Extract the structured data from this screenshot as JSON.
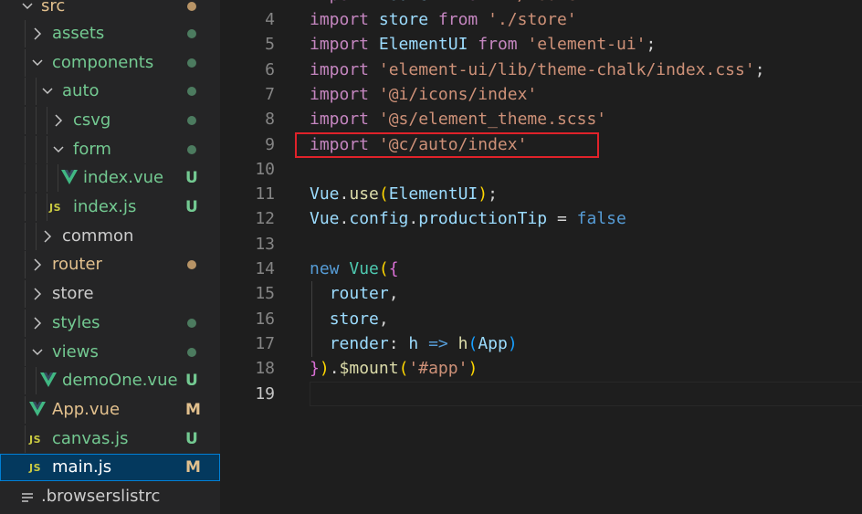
{
  "explorer": {
    "items": [
      {
        "label": "src",
        "status": "dot"
      },
      {
        "label": "assets",
        "status": "dot"
      },
      {
        "label": "components",
        "status": "dot"
      },
      {
        "label": "auto",
        "status": "dot"
      },
      {
        "label": "csvg",
        "status": "dot"
      },
      {
        "label": "form",
        "status": "dot"
      },
      {
        "label": "index.vue",
        "status": "U"
      },
      {
        "label": "index.js",
        "status": "U",
        "icon": "JS"
      },
      {
        "label": "common",
        "status": ""
      },
      {
        "label": "router",
        "status": "dot"
      },
      {
        "label": "store",
        "status": ""
      },
      {
        "label": "styles",
        "status": "dot"
      },
      {
        "label": "views",
        "status": "dot"
      },
      {
        "label": "demoOne.vue",
        "status": "U"
      },
      {
        "label": "App.vue",
        "status": "M"
      },
      {
        "label": "canvas.js",
        "status": "U",
        "icon": "JS"
      },
      {
        "label": "main.js",
        "status": "M",
        "icon": "JS"
      },
      {
        "label": ".browserslistrc",
        "status": ""
      }
    ]
  },
  "editor": {
    "lines": [
      {
        "n": "4",
        "t": [
          [
            "import",
            "kw"
          ],
          [
            " "
          ],
          [
            "store",
            "var"
          ],
          [
            " "
          ],
          [
            "from",
            "kw"
          ],
          [
            " "
          ],
          [
            "'./store'",
            "str"
          ]
        ]
      },
      {
        "n": "5",
        "t": [
          [
            "import",
            "kw"
          ],
          [
            " "
          ],
          [
            "ElementUI",
            "var"
          ],
          [
            " "
          ],
          [
            "from",
            "kw"
          ],
          [
            " "
          ],
          [
            "'element-ui'",
            "str"
          ],
          [
            ";"
          ]
        ]
      },
      {
        "n": "6",
        "t": [
          [
            "import",
            "kw"
          ],
          [
            " "
          ],
          [
            "'element-ui/lib/theme-chalk/index.css'",
            "str"
          ],
          [
            ";"
          ]
        ]
      },
      {
        "n": "7",
        "t": [
          [
            "import",
            "kw"
          ],
          [
            " "
          ],
          [
            "'@i/icons/index'",
            "str"
          ]
        ]
      },
      {
        "n": "8",
        "t": [
          [
            "import",
            "kw"
          ],
          [
            " "
          ],
          [
            "'@s/element_theme.scss'",
            "str"
          ]
        ]
      },
      {
        "n": "9",
        "t": [
          [
            "import",
            "kw"
          ],
          [
            " "
          ],
          [
            "'@c/auto/index'",
            "str"
          ]
        ]
      },
      {
        "n": "10",
        "t": []
      },
      {
        "n": "11",
        "t": [
          [
            "Vue",
            "var"
          ],
          [
            "."
          ],
          [
            "use",
            "fn"
          ],
          [
            "(",
            "b1"
          ],
          [
            "ElementUI",
            "var"
          ],
          [
            ")",
            "b1"
          ],
          [
            ";"
          ]
        ]
      },
      {
        "n": "12",
        "t": [
          [
            "Vue",
            "var"
          ],
          [
            "."
          ],
          [
            "config",
            "var"
          ],
          [
            "."
          ],
          [
            "productionTip",
            "var"
          ],
          [
            " = "
          ],
          [
            "false",
            "bool"
          ]
        ]
      },
      {
        "n": "13",
        "t": []
      },
      {
        "n": "14",
        "t": [
          [
            "new",
            "bool"
          ],
          [
            " "
          ],
          [
            "Vue",
            "cls"
          ],
          [
            "(",
            "b1"
          ],
          [
            "{",
            "b2"
          ]
        ]
      },
      {
        "n": "15",
        "t": [
          [
            "  "
          ],
          [
            "router",
            "var"
          ],
          [
            ","
          ]
        ]
      },
      {
        "n": "16",
        "t": [
          [
            "  "
          ],
          [
            "store",
            "var"
          ],
          [
            ","
          ]
        ]
      },
      {
        "n": "17",
        "t": [
          [
            "  "
          ],
          [
            "render",
            "var"
          ],
          [
            ": "
          ],
          [
            "h",
            "var"
          ],
          [
            " "
          ],
          [
            "=>",
            "bool"
          ],
          [
            " "
          ],
          [
            "h",
            "fn"
          ],
          [
            "(",
            "b3"
          ],
          [
            "App",
            "var"
          ],
          [
            ")",
            "b3"
          ]
        ]
      },
      {
        "n": "18",
        "t": [
          [
            "}",
            "b2"
          ],
          [
            ")",
            "b1"
          ],
          [
            "."
          ],
          [
            "$mount",
            "fn"
          ],
          [
            "(",
            "b1"
          ],
          [
            "'#app'",
            "str"
          ],
          [
            ")",
            "b1"
          ]
        ]
      },
      {
        "n": "19",
        "t": []
      }
    ]
  }
}
